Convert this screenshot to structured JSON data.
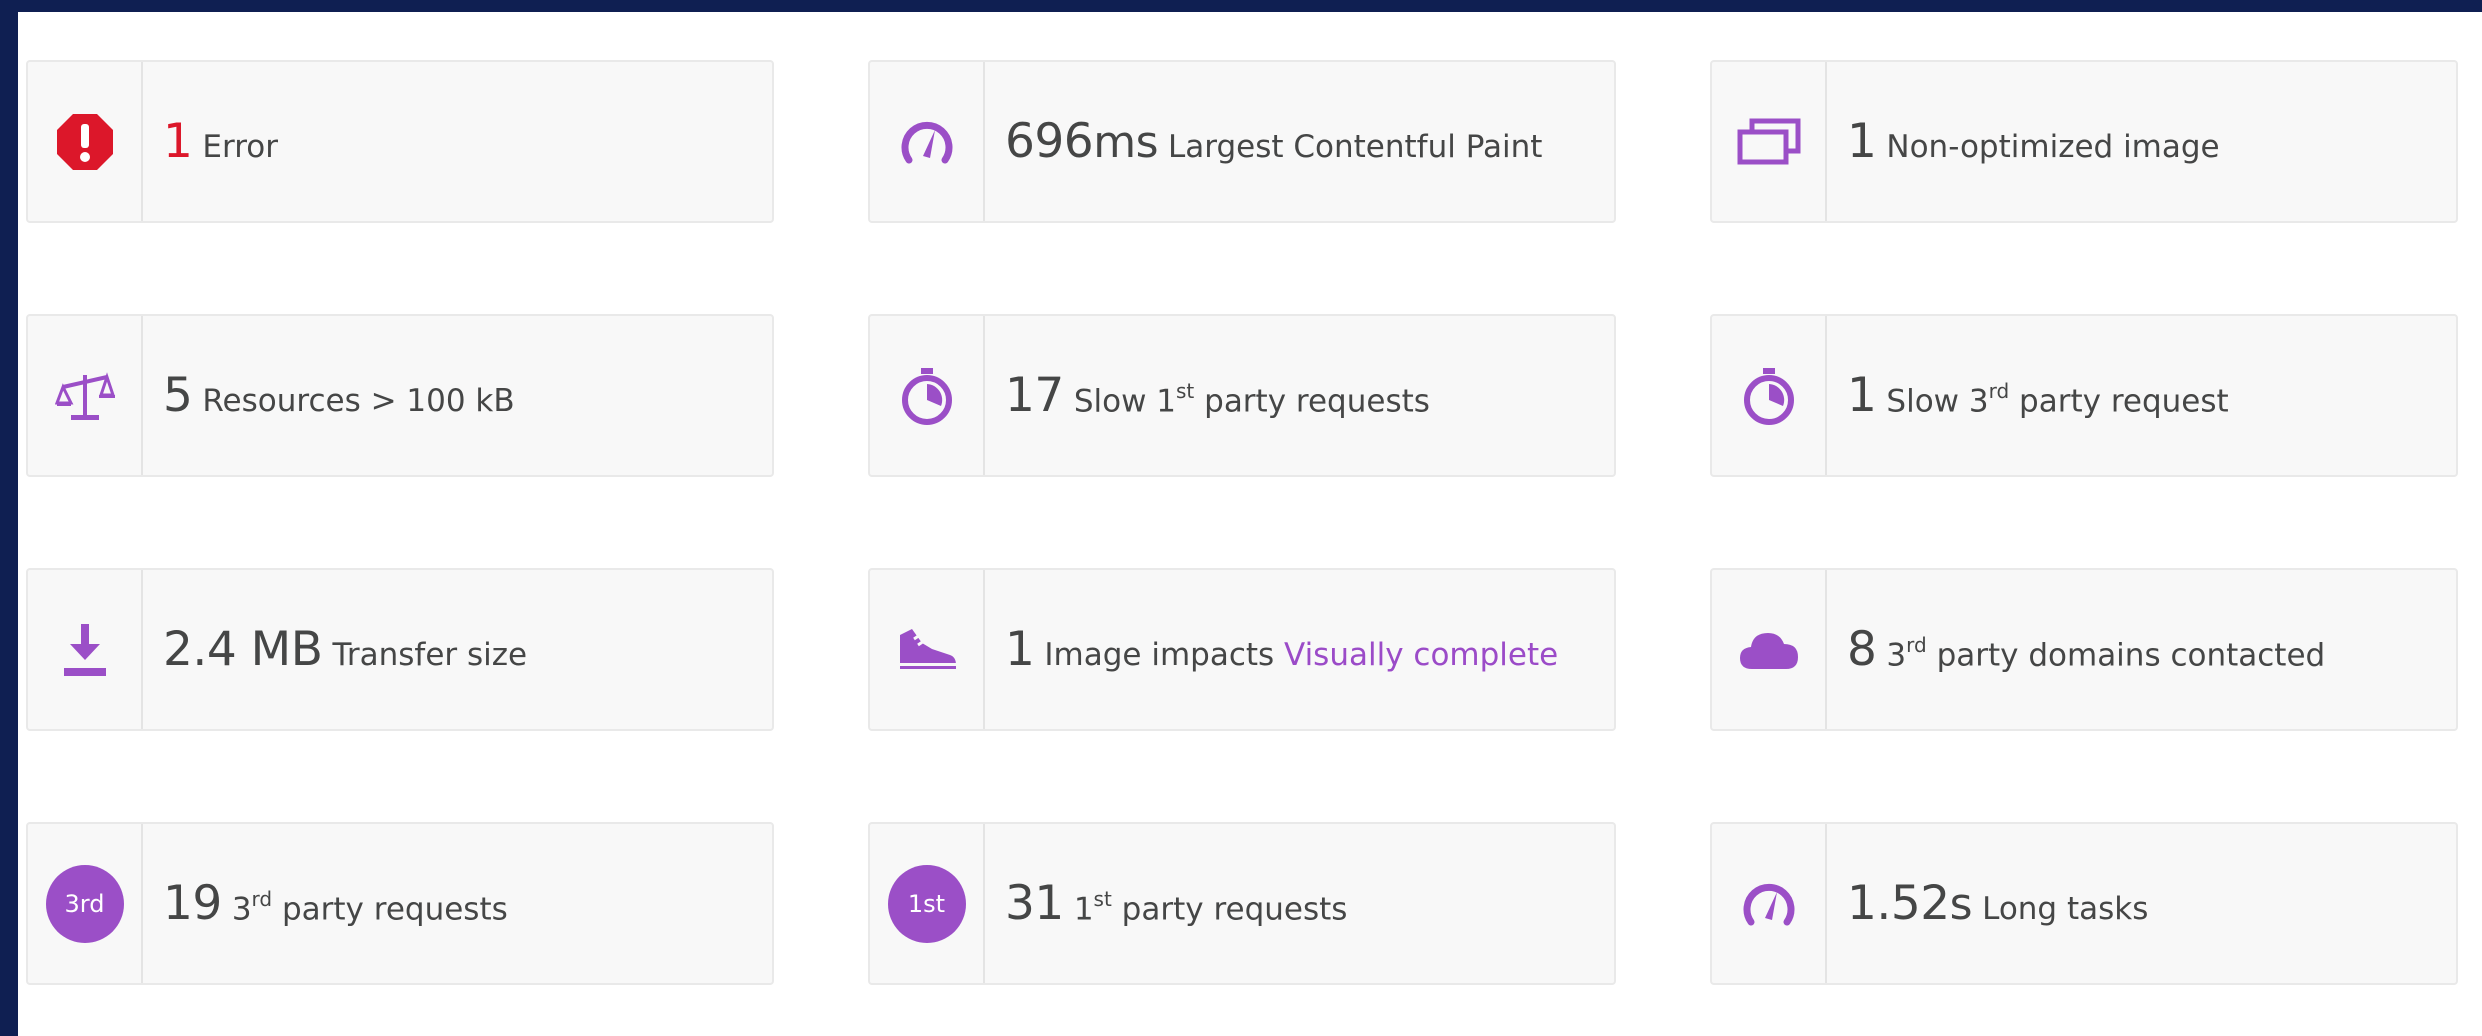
{
  "colors": {
    "accent": "#9b4fc7",
    "error": "#dc172a",
    "text": "#454646",
    "link": "#9b4bc8",
    "card_bg": "#f8f8f8",
    "frame": "#0f1f52"
  },
  "cards": [
    {
      "icon": "error-octagon-icon",
      "metric": "1",
      "label": "Error"
    },
    {
      "icon": "speedometer-icon",
      "metric": "696",
      "unit": "ms",
      "label": "Largest Contentful Paint"
    },
    {
      "icon": "image-stack-icon",
      "metric": "1",
      "label": "Non-optimized image"
    },
    {
      "icon": "scale-balance-icon",
      "metric": "5",
      "label": "Resources > 100 kB"
    },
    {
      "icon": "stopwatch-icon",
      "metric": "17",
      "label_pre": "Slow 1",
      "label_sup": "st",
      "label_post": " party requests"
    },
    {
      "icon": "stopwatch-icon",
      "metric": "1",
      "label_pre": "Slow 3",
      "label_sup": "rd",
      "label_post": " party request"
    },
    {
      "icon": "download-icon",
      "metric": "2.4 MB",
      "label": "Transfer size"
    },
    {
      "icon": "sneaker-icon",
      "metric": "1",
      "label": "Image impacts ",
      "link": "Visually complete"
    },
    {
      "icon": "cloud-icon",
      "metric": "8",
      "label_pre": "3",
      "label_sup": "rd",
      "label_post": " party domains contacted"
    },
    {
      "icon": "third-party-badge-icon",
      "badge": "3rd",
      "metric": "19",
      "label_pre": "3",
      "label_sup": "rd",
      "label_post": " party requests"
    },
    {
      "icon": "first-party-badge-icon",
      "badge": "1st",
      "metric": "31",
      "label_pre": "1",
      "label_sup": "st",
      "label_post": " party requests"
    },
    {
      "icon": "speedometer-icon",
      "metric": "1.52",
      "unit": "s",
      "label": "Long tasks"
    }
  ]
}
